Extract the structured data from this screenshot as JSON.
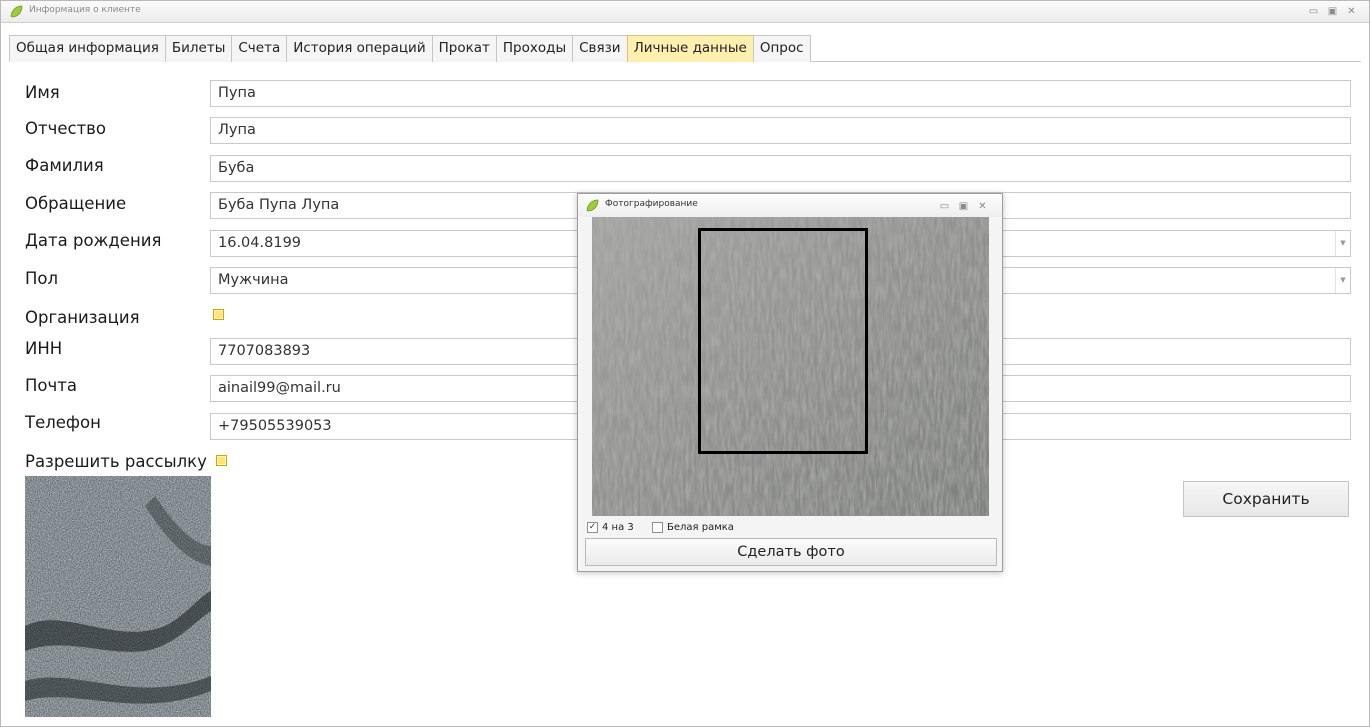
{
  "window": {
    "title": "Информация о клиенте"
  },
  "tabs": [
    {
      "label": "Общая информация"
    },
    {
      "label": "Билеты"
    },
    {
      "label": "Счета"
    },
    {
      "label": "История операций"
    },
    {
      "label": "Прокат"
    },
    {
      "label": "Проходы"
    },
    {
      "label": "Связи"
    },
    {
      "label": "Личные данные"
    },
    {
      "label": "Опрос"
    }
  ],
  "active_tab": "Личные данные",
  "form": {
    "first_name": {
      "label": "Имя",
      "value": "Пупа"
    },
    "patronymic": {
      "label": "Отчество",
      "value": "Лупа"
    },
    "last_name": {
      "label": "Фамилия",
      "value": "Буба"
    },
    "salutation": {
      "label": "Обращение",
      "value": "Буба Пупа Лупа"
    },
    "birth_date": {
      "label": "Дата рождения",
      "value": "16.04.8199"
    },
    "gender": {
      "label": "Пол",
      "value": "Мужчина"
    },
    "organization": {
      "label": "Организация",
      "checked": false
    },
    "inn": {
      "label": "ИНН",
      "value": "7707083893"
    },
    "email": {
      "label": "Почта",
      "value": "ainail99@mail.ru"
    },
    "phone": {
      "label": "Телефон",
      "value": "+79505539053"
    },
    "allow_mailing": {
      "label": "Разрешить рассылку",
      "checked": false
    }
  },
  "save_button": {
    "label": "Сохранить"
  },
  "photo_dialog": {
    "title": "Фотографирование",
    "option_4x3": {
      "label": "4 на 3",
      "checked": true
    },
    "option_white_frame": {
      "label": "Белая рамка",
      "checked": false
    },
    "take_photo_button": {
      "label": "Сделать фото"
    }
  },
  "colors": {
    "active_tab": "#fff0b0",
    "checkbox_fill": "#ffe37a",
    "window_border": "#b9b9b9"
  }
}
